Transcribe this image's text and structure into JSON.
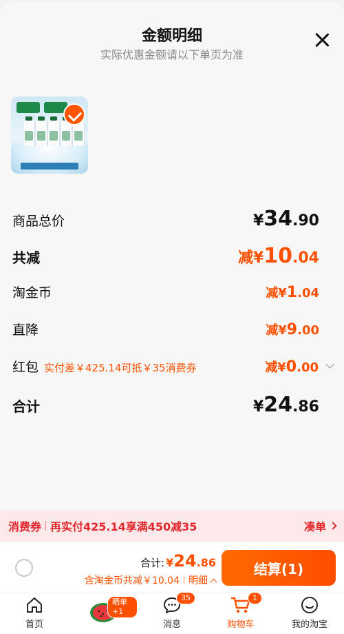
{
  "header": {
    "title": "金额明细",
    "subtitle": "实际优惠金额请以下单页为准",
    "close_icon": "close-icon"
  },
  "product": {
    "selected": true
  },
  "rows": {
    "total_price": {
      "label": "商品总价",
      "yen": "¥",
      "int": "34",
      "dec": ".90"
    },
    "total_discount": {
      "label": "共减",
      "prefix": "减",
      "yen": "¥",
      "int": "10",
      "dec": ".04"
    },
    "taojinbi": {
      "label": "淘金币",
      "prefix": "减",
      "yen": "¥",
      "int": "1",
      "dec": ".04"
    },
    "zhijiang": {
      "label": "直降",
      "prefix": "减",
      "yen": "¥",
      "int": "9",
      "dec": ".00"
    },
    "redpacket": {
      "label": "红包",
      "note": "实付差￥425.14可抵￥35消费券",
      "prefix": "减",
      "yen": "¥",
      "int": "0",
      "dec": ".00"
    },
    "sum": {
      "label": "合计",
      "yen": "¥",
      "int": "24",
      "dec": ".86"
    }
  },
  "coupon_strip": {
    "tag": "消费券",
    "message": "再实付425.14享满450减35",
    "action": "凑单"
  },
  "checkout": {
    "total_label": "合计:",
    "yen": "¥",
    "int": "24",
    "dec": ".86",
    "savings": "含淘金币共减￥10.04",
    "detail": "明细",
    "settle": "结算(1)"
  },
  "tabbar": {
    "tabs": [
      {
        "label": "首页",
        "icon": "home-icon"
      },
      {
        "label": "",
        "icon": "watermelon-icon",
        "badge": "晒单+1"
      },
      {
        "label": "消息",
        "icon": "message-icon",
        "badge": "35"
      },
      {
        "label": "购物车",
        "icon": "cart-icon",
        "badge": "1",
        "active": true
      },
      {
        "label": "我的淘宝",
        "icon": "profile-icon"
      }
    ]
  },
  "colors": {
    "accent": "#ff5000",
    "coupon_red": "#e0282e",
    "coupon_bg": "#fde8ea"
  }
}
